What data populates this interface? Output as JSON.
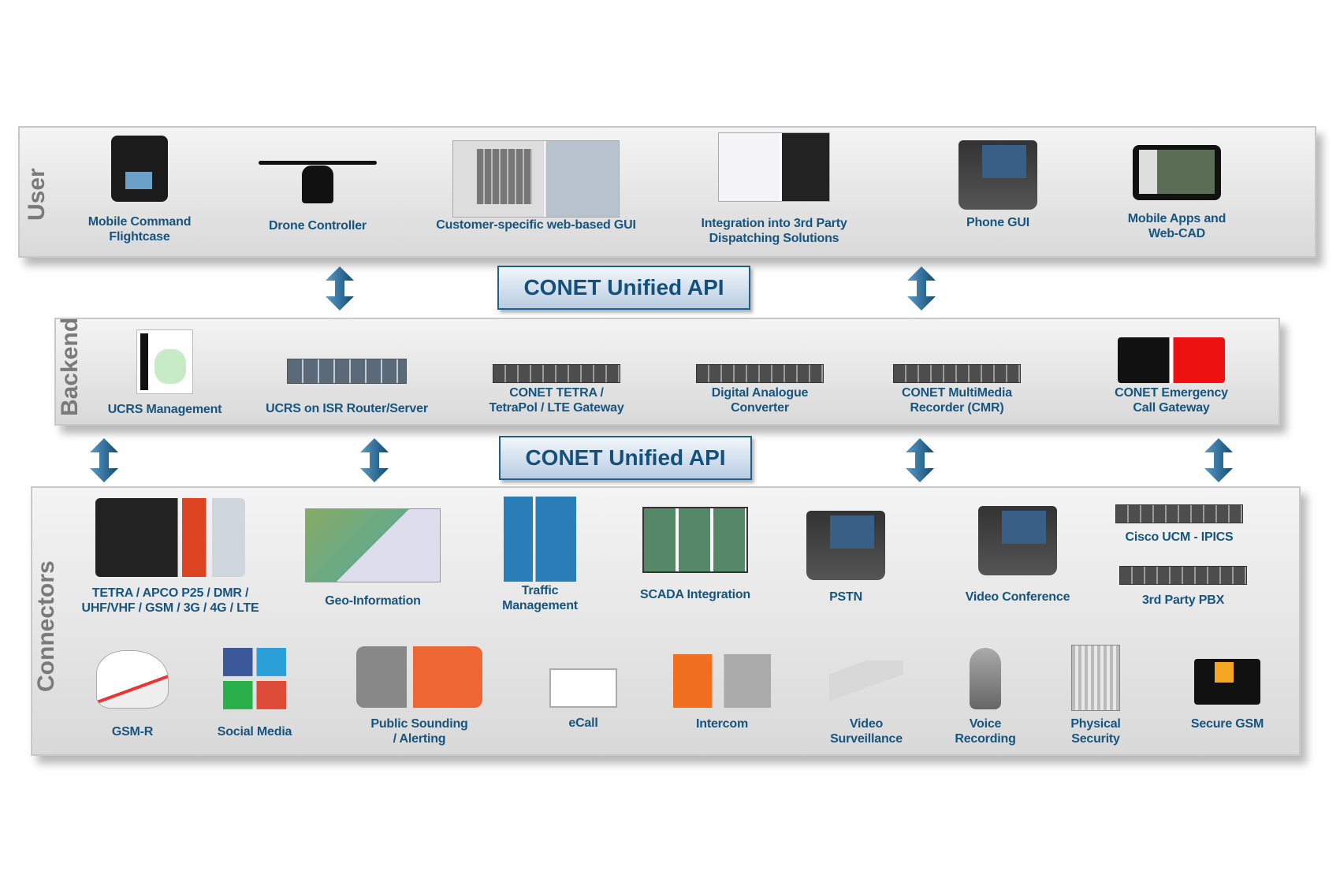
{
  "sections": {
    "user": "User",
    "backend": "Backend",
    "connectors": "Connectors"
  },
  "api_label": "CONET Unified API",
  "colors": {
    "label": "#17557f",
    "arrow": "#1f5f8b",
    "side_label": "#7a7a7a",
    "panel": "#e6e6e6"
  },
  "user": {
    "items": [
      {
        "icon": "flightcase-icon",
        "lines": [
          "Mobile Command",
          "Flightcase"
        ]
      },
      {
        "icon": "drone-icon",
        "lines": [
          "Drone Controller"
        ]
      },
      {
        "icon": "web-gui-icon",
        "lines": [
          "Customer-specific  web-based GUI"
        ]
      },
      {
        "icon": "dispatch-screens-icon",
        "lines": [
          "Integration  into  3rd Party",
          "Dispatching Solutions"
        ]
      },
      {
        "icon": "video-phone-icon",
        "lines": [
          "Phone GUI"
        ]
      },
      {
        "icon": "tablet-icon",
        "lines": [
          "Mobile  Apps and",
          "Web-CAD"
        ]
      }
    ]
  },
  "backend": {
    "items": [
      {
        "icon": "map-document-icon",
        "lines": [
          "UCRS Management"
        ]
      },
      {
        "icon": "server-icon",
        "lines": [
          "UCRS on ISR Router/Server"
        ]
      },
      {
        "icon": "gateway-server-icon",
        "lines": [
          "CONET TETRA /",
          "TetraPol  / LTE Gateway"
        ]
      },
      {
        "icon": "converter-server-icon",
        "lines": [
          "Digital  Analogue",
          "Converter"
        ]
      },
      {
        "icon": "recorder-server-icon",
        "lines": [
          "CONET MultiMedia",
          "Recorder (CMR)"
        ]
      },
      {
        "icon": "emergency-911-112-icon",
        "lines": [
          "CONET Emergency",
          "Call  Gateway"
        ]
      }
    ]
  },
  "connectors": {
    "items": [
      {
        "icon": "radio-phone-icon",
        "lines": [
          "TETRA / APCO P25 / DMR /",
          "UHF/VHF / GSM / 3G / 4G / LTE"
        ]
      },
      {
        "icon": "geo-map-icon",
        "lines": [
          "Geo-Information"
        ]
      },
      {
        "icon": "traffic-sign-icon",
        "lines": [
          "Traffic",
          "Management"
        ]
      },
      {
        "icon": "scada-screens-icon",
        "lines": [
          "SCADA Integration"
        ]
      },
      {
        "icon": "desk-phone-icon",
        "lines": [
          "PSTN"
        ]
      },
      {
        "icon": "video-phone-icon",
        "lines": [
          "Video Conference"
        ]
      },
      {
        "icon": "server-icon",
        "lines": [
          "Cisco  UCM - IPICS"
        ]
      },
      {
        "icon": "server-icon",
        "lines": [
          "3rd Party PBX"
        ]
      },
      {
        "icon": "train-icon",
        "lines": [
          "GSM-R"
        ]
      },
      {
        "icon": "social-media-icon",
        "lines": [
          "Social Media"
        ]
      },
      {
        "icon": "siren-alert-icon",
        "lines": [
          "Public Sounding",
          "/ Alerting"
        ]
      },
      {
        "icon": "ecall-icon",
        "lines": [
          "eCall"
        ]
      },
      {
        "icon": "intercom-icon",
        "lines": [
          "Intercom"
        ]
      },
      {
        "icon": "camera-icon",
        "lines": [
          "Video",
          "Surveillance"
        ]
      },
      {
        "icon": "microphone-icon",
        "lines": [
          "Voice",
          "Recording"
        ]
      },
      {
        "icon": "turnstile-icon",
        "lines": [
          "Physical",
          "Security"
        ]
      },
      {
        "icon": "micro-sd-icon",
        "lines": [
          "Secure GSM"
        ]
      }
    ]
  }
}
